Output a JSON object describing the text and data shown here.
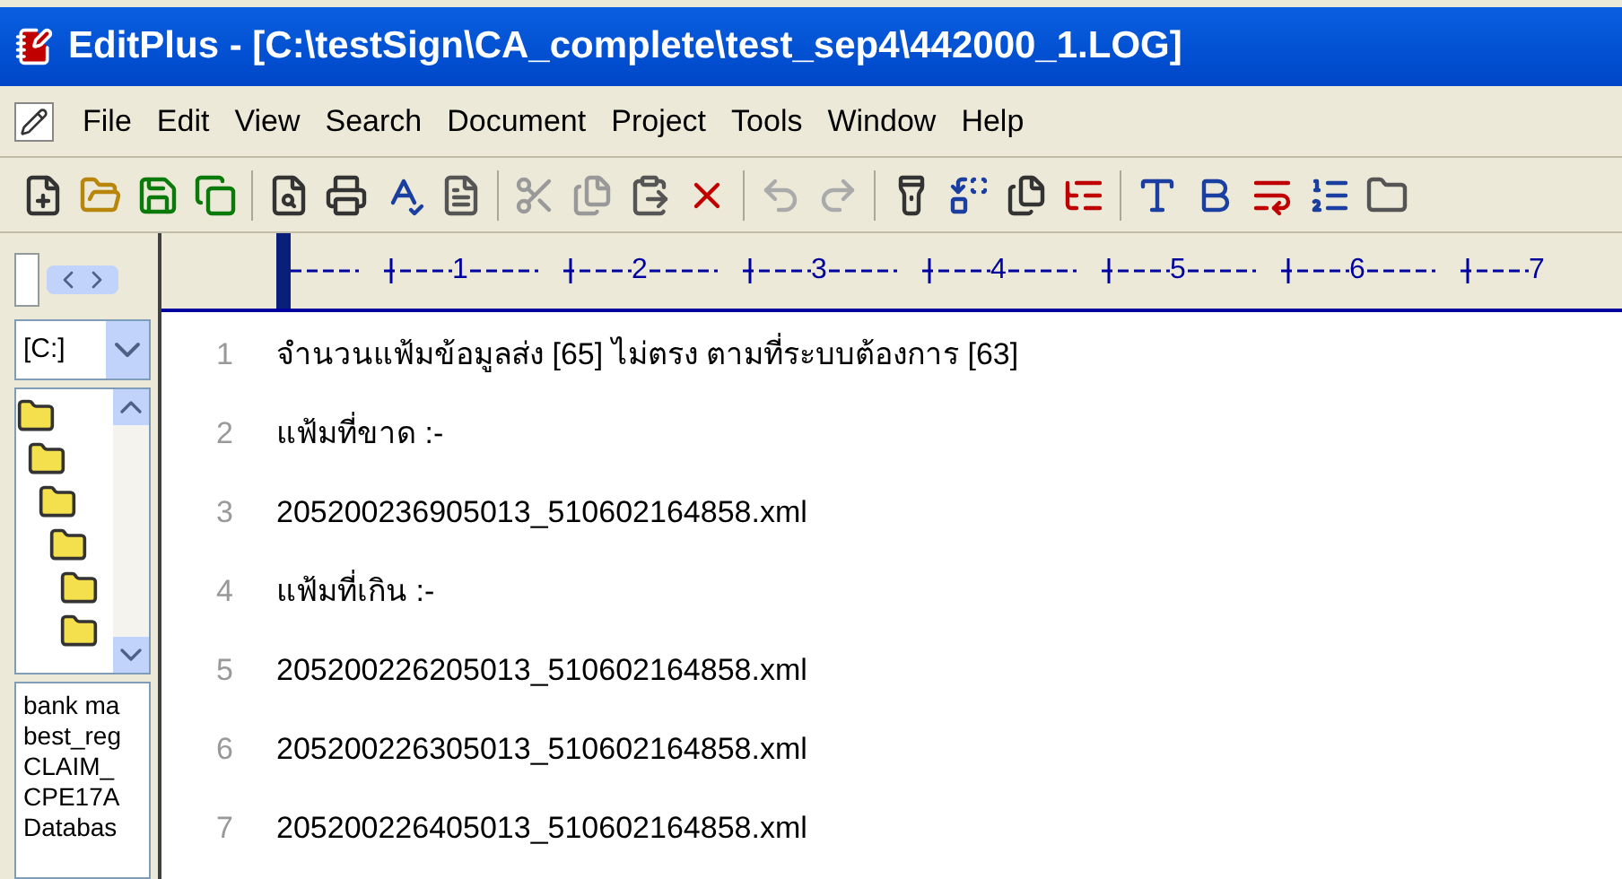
{
  "window": {
    "title": "EditPlus - [C:\\testSign\\CA_complete\\test_sep4\\442000_1.LOG]"
  },
  "menu": [
    "File",
    "Edit",
    "View",
    "Search",
    "Document",
    "Project",
    "Tools",
    "Window",
    "Help"
  ],
  "sidebar": {
    "drive": "[C:]",
    "files": [
      "bank ma",
      "best_reg",
      "CLAIM_",
      "CPE17A",
      "Databas"
    ]
  },
  "ruler": [
    "1",
    "2",
    "3",
    "4",
    "5",
    "6",
    "7"
  ],
  "lines": [
    {
      "number": "1",
      "text": "จำนวนแฟ้มข้อมูลส่ง [65] ไม่ตรง ตามที่ระบบต้องการ [63]"
    },
    {
      "number": "2",
      "text": "แฟ้มที่ขาด :-"
    },
    {
      "number": "3",
      "text": "205200236905013_510602164858.xml"
    },
    {
      "number": "4",
      "text": "แฟ้มที่เกิน :-"
    },
    {
      "number": "5",
      "text": "205200226205013_510602164858.xml"
    },
    {
      "number": "6",
      "text": "205200226305013_510602164858.xml"
    },
    {
      "number": "7",
      "text": "205200226405013_510602164858.xml"
    }
  ]
}
